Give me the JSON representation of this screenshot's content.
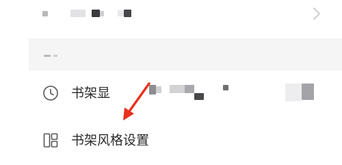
{
  "menu": {
    "items": [
      {
        "label": "书架显",
        "icon": "clock-icon"
      },
      {
        "label": "书架风格设置",
        "icon": "layout-icon"
      }
    ]
  },
  "icons": {
    "top_chevron": "chevron-right-icon",
    "annotation": "red-arrow-icon"
  },
  "colors": {
    "text": "#2b2b2b",
    "icon": "#555555",
    "banner": "#f5f5f6",
    "chevron": "#c4c4c4",
    "annotation": "#e8321e"
  }
}
